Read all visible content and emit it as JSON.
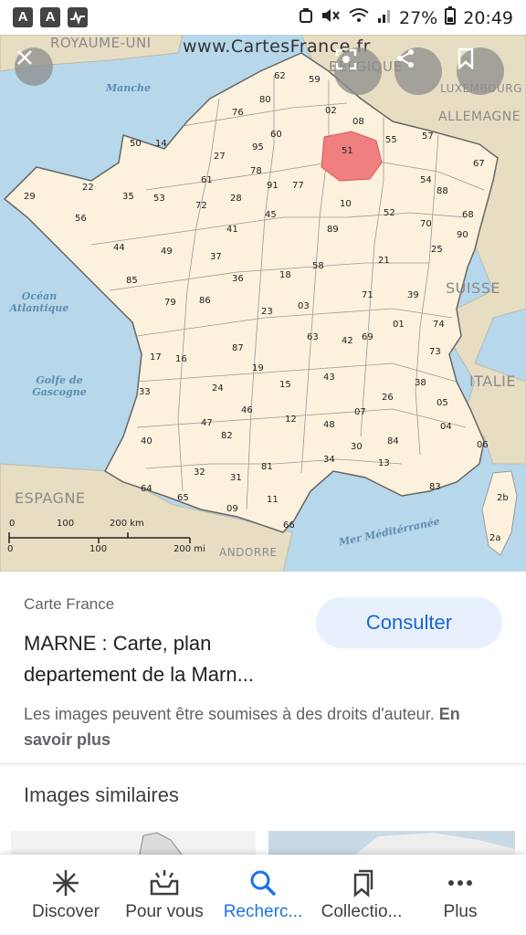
{
  "status_bar": {
    "left_icons": [
      "app-a-icon",
      "app-a-icon",
      "activity-icon"
    ],
    "battery_percent": "27%",
    "time": "20:49"
  },
  "image_viewer": {
    "map_header": "www.CartesFrance.fr",
    "country_labels": [
      "ROYAUME-UNI",
      "BELGIQUE",
      "LUXEMBOURG",
      "ALLEMAGNE",
      "SUISSE",
      "ITALIE",
      "ESPAGNE",
      "ANDORRE"
    ],
    "sea_labels": [
      "Manche",
      "Océan Atlantique",
      "Golfe de Gascogne",
      "Mer Méditérranée"
    ],
    "scale_km": [
      "0",
      "100",
      "200 km"
    ],
    "scale_mi": [
      "0",
      "100",
      "200 mi"
    ],
    "highlighted_department": "51",
    "departments": [
      "62",
      "59",
      "80",
      "76",
      "02",
      "08",
      "60",
      "50",
      "14",
      "27",
      "95",
      "57",
      "55",
      "51",
      "67",
      "78",
      "91",
      "77",
      "29",
      "22",
      "35",
      "53",
      "61",
      "72",
      "28",
      "54",
      "88",
      "56",
      "10",
      "45",
      "52",
      "68",
      "44",
      "49",
      "41",
      "37",
      "89",
      "70",
      "90",
      "25",
      "36",
      "18",
      "58",
      "21",
      "85",
      "79",
      "86",
      "71",
      "39",
      "23",
      "03",
      "01",
      "74",
      "87",
      "63",
      "42",
      "69",
      "17",
      "16",
      "19",
      "15",
      "43",
      "73",
      "38",
      "33",
      "24",
      "26",
      "46",
      "12",
      "07",
      "48",
      "05",
      "04",
      "47",
      "82",
      "40",
      "81",
      "30",
      "84",
      "06",
      "32",
      "34",
      "13",
      "64",
      "31",
      "65",
      "09",
      "11",
      "83",
      "66",
      "2b",
      "2a"
    ],
    "close_icon": "close-icon",
    "lens_icon": "lens-icon",
    "share_icon": "share-icon",
    "bookmark_icon": "bookmark-icon"
  },
  "result": {
    "source": "Carte France",
    "title": "MARNE : Carte, plan departement de la Marn...",
    "consult_label": "Consulter",
    "rights_text": "Les images peuvent être soumises à des droits d'auteur.",
    "learn_more": "En savoir plus"
  },
  "similar": {
    "heading": "Images similaires"
  },
  "bottom_nav": {
    "items": [
      {
        "label": "Discover",
        "icon": "asterisk-icon"
      },
      {
        "label": "Pour vous",
        "icon": "inbox-icon"
      },
      {
        "label": "Recherc...",
        "icon": "search-icon",
        "active": true
      },
      {
        "label": "Collectio...",
        "icon": "collections-icon"
      },
      {
        "label": "Plus",
        "icon": "more-icon"
      }
    ]
  },
  "colors": {
    "accent": "#1a73e8",
    "consult_bg": "#e8f0fe",
    "highlight": "#f08080",
    "land": "#fbf1dc",
    "neighbor_land": "#e7ddc3",
    "sea": "#b7d7ea"
  }
}
